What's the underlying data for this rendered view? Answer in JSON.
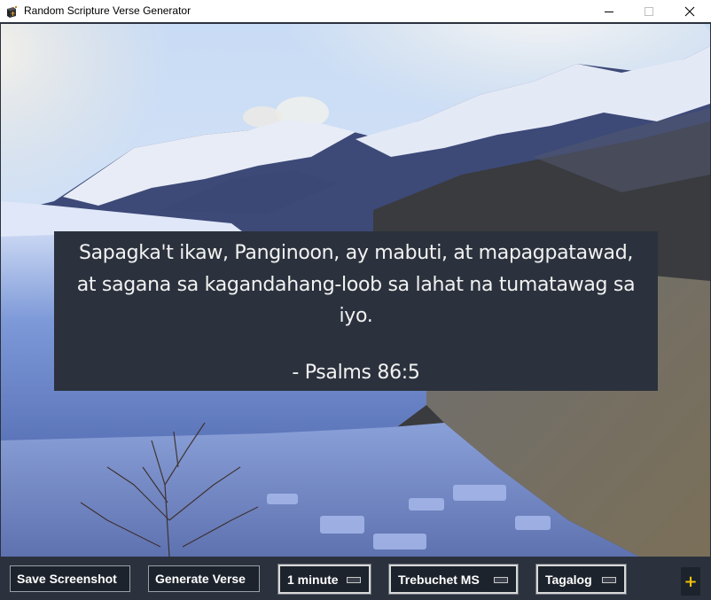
{
  "window": {
    "title": "Random Scripture Verse Generator",
    "icon": "bible-book-icon",
    "controls": [
      "minimize-icon",
      "maximize-icon",
      "close-icon"
    ]
  },
  "verse": {
    "text": "Sapagka't ikaw, Panginoon, ay mabuti, at mapagpatawad, at sagana sa kagandahang-loob sa lahat na tumatawag sa iyo.",
    "reference": "- Psalms 86:5"
  },
  "background": {
    "description": "Snowy mountains above a blue glacier and icy lake"
  },
  "toolbar": {
    "save_label": "Save Screenshot",
    "generate_label": "Generate Verse",
    "interval_selected": "1 minute",
    "font_selected": "Trebuchet MS",
    "language_selected": "Tagalog",
    "add_label": "+"
  },
  "colors": {
    "panel": "#2b323d",
    "button_bg": "#1d232c",
    "accent_plus": "#f4c20d",
    "text": "#ffffff"
  }
}
